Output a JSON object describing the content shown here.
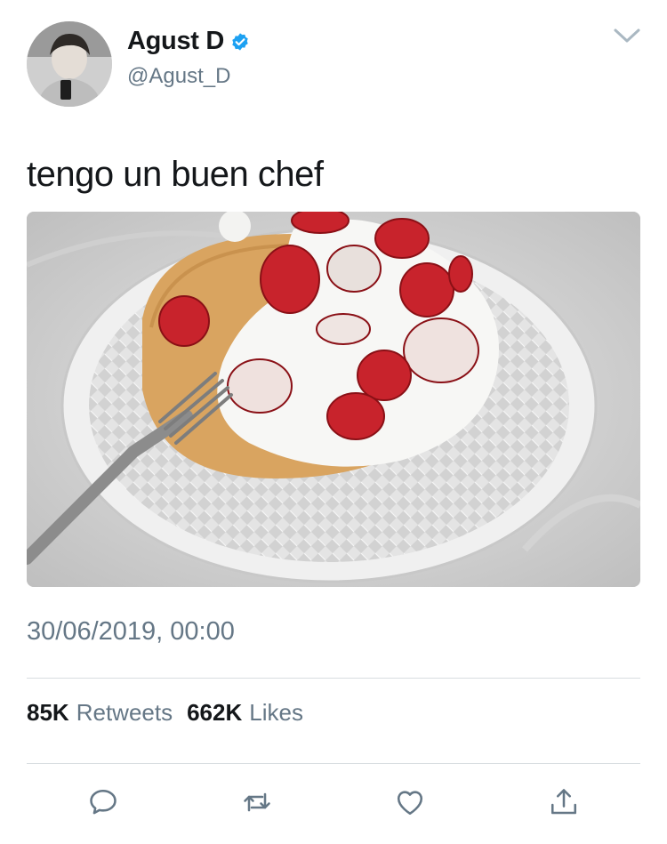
{
  "profile": {
    "display_name": "Agust D",
    "handle": "@Agust_D"
  },
  "icons": {
    "verified": "verified-badge-icon",
    "menu": "chevron-down-icon",
    "reply": "reply-icon",
    "retweet": "retweet-icon",
    "like": "heart-icon",
    "share": "share-icon"
  },
  "tweet": {
    "text": "tengo un buen chef",
    "timestamp": "30/06/2019, 00:00"
  },
  "stats": {
    "retweets_count": "85K",
    "retweets_label": "Retweets",
    "likes_count": "662K",
    "likes_label": "Likes"
  },
  "colors": {
    "primary_text": "#14171a",
    "secondary_text": "#657786",
    "verified_blue": "#1da1f2",
    "divider": "#d8dde1"
  }
}
